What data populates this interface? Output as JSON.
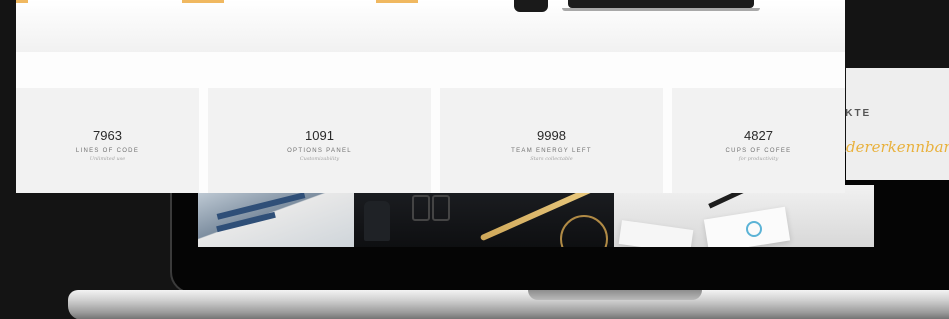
{
  "stats": [
    {
      "number": "7963",
      "label": "LINES OF CODE",
      "sub": "Unlimited use"
    },
    {
      "number": "1091",
      "label": "OPTIONS PANEL",
      "sub": "Customizability"
    },
    {
      "number": "9998",
      "label": "TEAM ENERGY LEFT",
      "sub": "Stars collectable"
    },
    {
      "number": "4827",
      "label": "CUPS OF COFEE",
      "sub": "for productivity"
    }
  ],
  "side_section": {
    "heading": "UKTE",
    "tagline": "dererkennbar, f"
  },
  "colors": {
    "accent": "#f0b860",
    "tagline": "#e9b13c",
    "stat_tile": "#f2f2f2",
    "page": "#fdfdfd",
    "background": "#141414"
  }
}
